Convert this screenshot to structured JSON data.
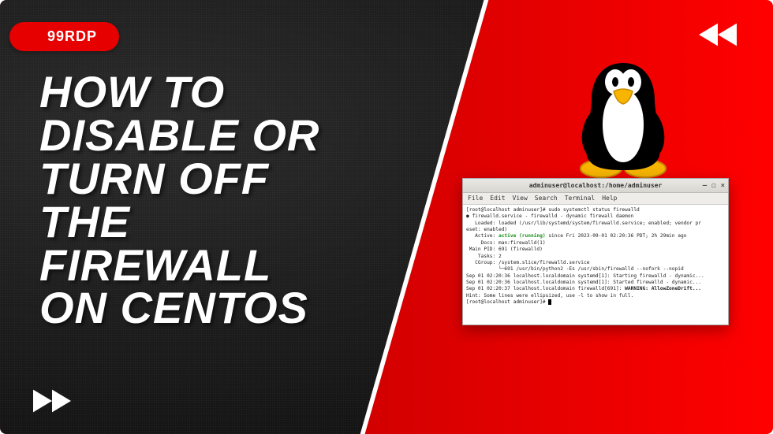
{
  "badge": {
    "label": "99RDP"
  },
  "headline": "HOW TO\nDISABLE OR\nTURN OFF\nTHE\nFIREWALL\nON CENTOS",
  "mascot": {
    "name": "tux-linux-penguin"
  },
  "colors": {
    "accent": "#e60000",
    "bg_right": "#ff0000",
    "bg_left": "#1a1a1a"
  },
  "terminal": {
    "title": "adminuser@localhost:/home/adminuser",
    "menu": [
      "File",
      "Edit",
      "View",
      "Search",
      "Terminal",
      "Help"
    ],
    "controls": [
      "–",
      "◻",
      "×"
    ],
    "lines": [
      {
        "t": "[root@localhost adminuser]# sudo systemctl status firewalld"
      },
      {
        "t": "● firewalld.service - firewalld - dynamic firewall daemon"
      },
      {
        "t": "   Loaded: loaded (/usr/lib/systemd/system/firewalld.service; enabled; vendor pr"
      },
      {
        "t": "eset: enabled)"
      },
      {
        "pre": "   Active: ",
        "active": "active (running)",
        "post": " since Fri 2023-09-01 02:20:36 PDT; 2h 29min ago"
      },
      {
        "t": "     Docs: man:firewalld(1)"
      },
      {
        "t": " Main PID: 691 (firewalld)"
      },
      {
        "t": "    Tasks: 2"
      },
      {
        "t": "   CGroup: /system.slice/firewalld.service"
      },
      {
        "t": "           └─691 /usr/bin/python2 -Es /usr/sbin/firewalld --nofork --nopid"
      },
      {
        "t": ""
      },
      {
        "t": "Sep 01 02:20:36 localhost.localdomain systemd[1]: Starting firewalld - dynamic..."
      },
      {
        "t": "Sep 01 02:20:36 localhost.localdomain systemd[1]: Started firewalld - dynamic..."
      },
      {
        "pre": "Sep 01 02:20:37 localhost.localdomain firewalld[691]: ",
        "bold": "WARNING: AllowZoneDrift..."
      },
      {
        "t": "Hint: Some lines were ellipsized, use -l to show in full."
      },
      {
        "prompt": "[root@localhost adminuser]# "
      }
    ]
  }
}
